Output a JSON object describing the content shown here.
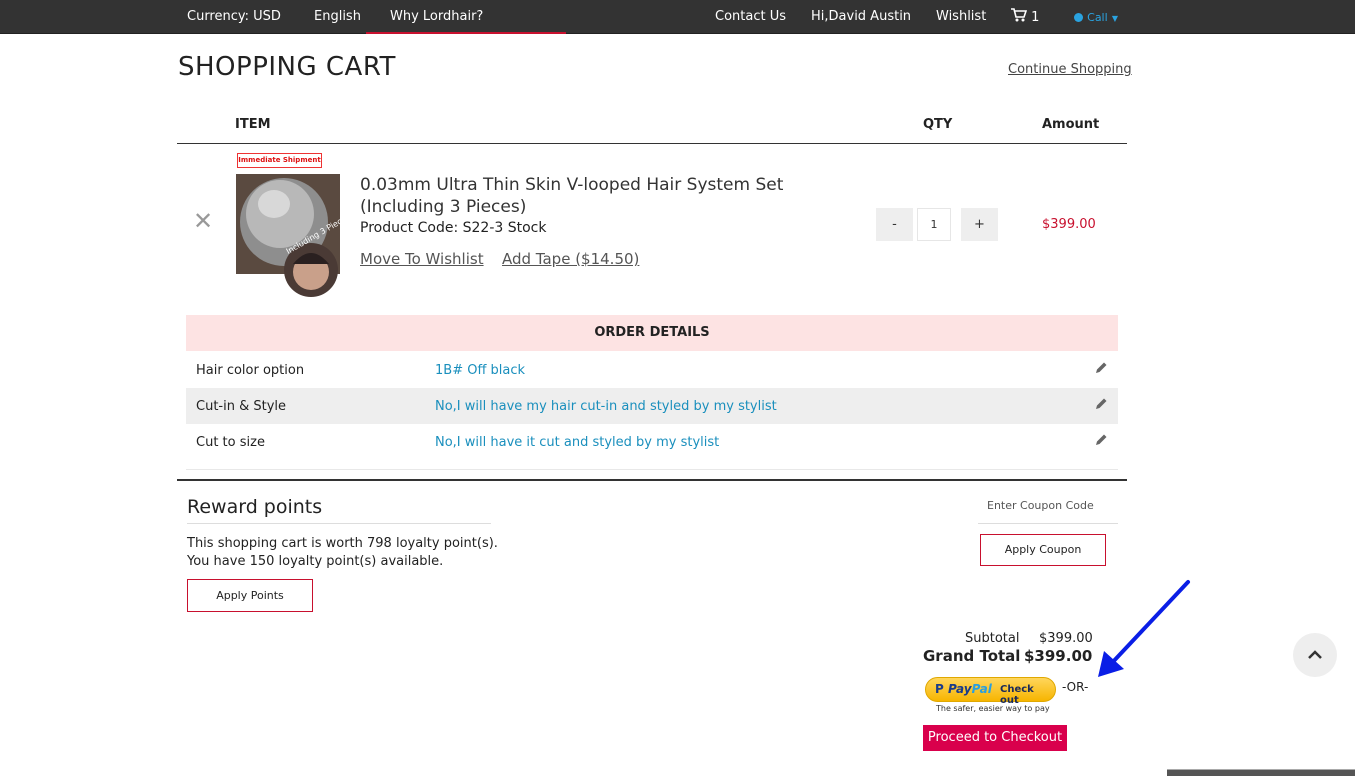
{
  "topbar": {
    "currency_label": "Currency:",
    "currency_value": "USD",
    "language": "English",
    "why": "Why Lordhair?",
    "contact": "Contact Us",
    "greeting": "Hi,David Austin",
    "wishlist": "Wishlist",
    "cart_count": "1",
    "call": "Call"
  },
  "page": {
    "title": "SHOPPING CART",
    "continue_shopping": "Continue Shopping"
  },
  "table": {
    "col_item": "ITEM",
    "col_qty": "QTY",
    "col_amount": "Amount"
  },
  "item": {
    "badge": "Immediate Shipment",
    "name": "0.03mm Ultra Thin Skin V-looped Hair System Set (Including 3 Pieces)",
    "product_code": "Product Code: S22-3 Stock",
    "move_to_wishlist": "Move To Wishlist",
    "add_tape": "Add Tape ($14.50)",
    "qty_minus": "-",
    "qty": "1",
    "qty_plus": "+",
    "amount": "$399.00"
  },
  "order_details": {
    "heading": "ORDER DETAILS",
    "rows": [
      {
        "label": "Hair color option",
        "value": "1B# Off black"
      },
      {
        "label": "Cut-in & Style",
        "value": "No,I will have my hair cut-in and styled by my stylist"
      },
      {
        "label": "Cut to size",
        "value": "No,I will have it cut and styled by my stylist"
      }
    ]
  },
  "reward": {
    "title": "Reward points",
    "line1": "This shopping cart is worth 798 loyalty point(s).",
    "line2": "You have 150 loyalty point(s) available.",
    "apply_points": "Apply Points"
  },
  "coupon": {
    "placeholder": "Enter Coupon Code",
    "apply": "Apply Coupon"
  },
  "totals": {
    "subtotal_label": "Subtotal",
    "subtotal": "$399.00",
    "grand_label": "Grand Total",
    "grand_total": "$399.00"
  },
  "paypal": {
    "logo_pay": "Pay",
    "logo_pal": "Pal",
    "checkout_text": "Check out",
    "tagline": "The safer, easier way to pay"
  },
  "or_text": "-OR-",
  "checkout_button": "Proceed to Checkout",
  "colors": {
    "topbar": "#333333",
    "accent_red": "#c8102e",
    "checkout_pink": "#d9004c",
    "link_blue": "#1a8fbd",
    "annotation_arrow": "#0a1ee6"
  }
}
